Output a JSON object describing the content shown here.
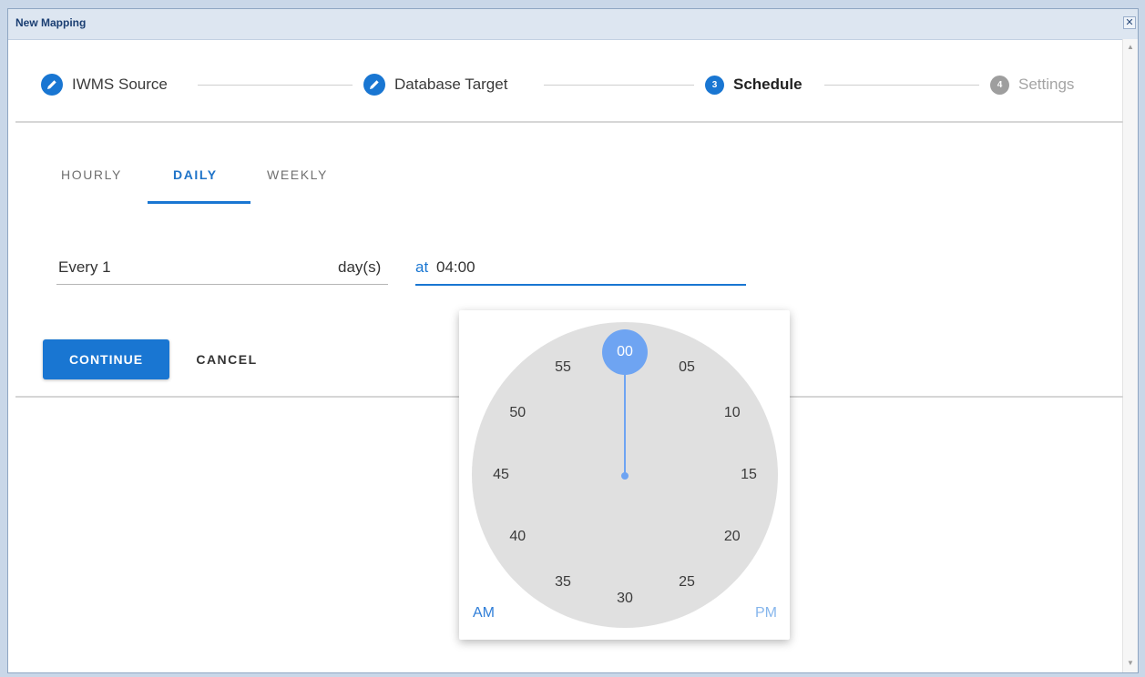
{
  "window": {
    "title": "New Mapping",
    "close_glyph": "✕"
  },
  "stepper": {
    "steps": [
      {
        "label": "IWMS Source",
        "icon": "pencil-icon",
        "state": "completed"
      },
      {
        "label": "Database Target",
        "icon": "pencil-icon",
        "state": "completed"
      },
      {
        "label": "Schedule",
        "number": "3",
        "state": "active"
      },
      {
        "label": "Settings",
        "number": "4",
        "state": "disabled"
      }
    ]
  },
  "tabs": [
    {
      "label": "HOURLY",
      "active": false
    },
    {
      "label": "DAILY",
      "active": true
    },
    {
      "label": "WEEKLY",
      "active": false
    }
  ],
  "form": {
    "every_value": "Every 1",
    "every_unit": "day(s)",
    "time_prefix": "at",
    "time_value": "04:00"
  },
  "buttons": {
    "continue": "CONTINUE",
    "cancel": "CANCEL"
  },
  "clock": {
    "mode": "minutes",
    "selected": "00",
    "numbers": [
      "00",
      "05",
      "10",
      "15",
      "20",
      "25",
      "30",
      "35",
      "40",
      "45",
      "50",
      "55"
    ],
    "am": "AM",
    "pm": "PM",
    "selected_period": "AM"
  },
  "colors": {
    "primary": "#1976d2",
    "clock_accent": "#6ea4f2",
    "disabled": "#9e9e9e"
  }
}
